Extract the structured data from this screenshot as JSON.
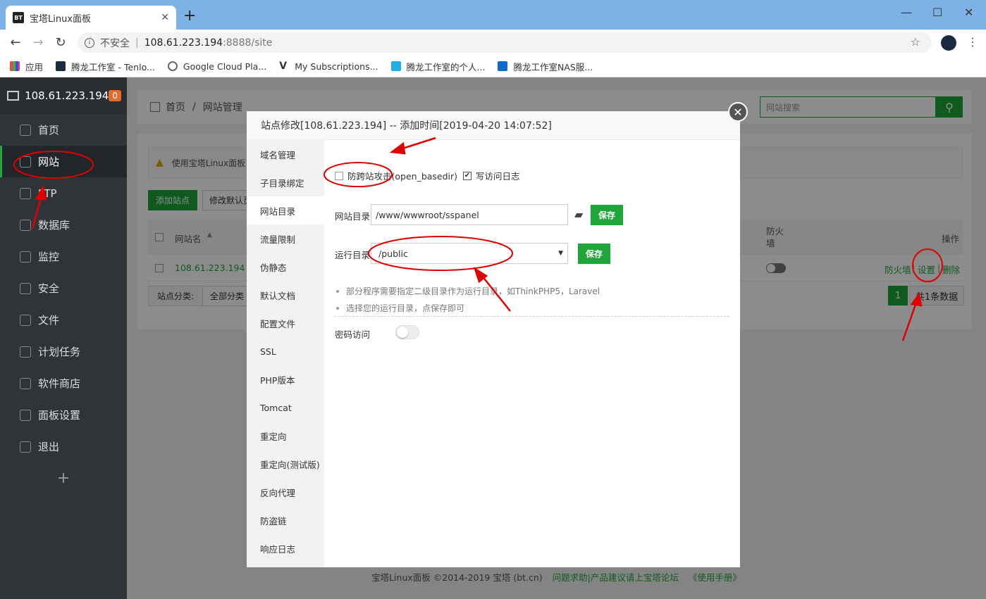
{
  "browser": {
    "tab_title": "宝塔Linux面板",
    "tab_favicon_text": "BT",
    "address": {
      "insecure_label": "不安全",
      "host": "108.61.223.194",
      "path": ":8888/site"
    },
    "bookmarks": [
      {
        "label": "应用",
        "icon": "apps-icon"
      },
      {
        "label": "腾龙工作室 - Tenlo...",
        "icon": "site-icon"
      },
      {
        "label": "Google Cloud Pla...",
        "icon": "gcp-icon"
      },
      {
        "label": "My Subscriptions...",
        "icon": "v-icon"
      },
      {
        "label": "腾龙工作室的个人...",
        "icon": "bilibili-icon"
      },
      {
        "label": "腾龙工作室NAS服...",
        "icon": "dsm-icon"
      }
    ]
  },
  "sidebar": {
    "server": "108.61.223.194",
    "badge": "0",
    "items": [
      {
        "label": "首页",
        "icon": "home-icon"
      },
      {
        "label": "网站",
        "icon": "globe-icon",
        "active": true
      },
      {
        "label": "FTP",
        "icon": "ftp-icon"
      },
      {
        "label": "数据库",
        "icon": "database-icon"
      },
      {
        "label": "监控",
        "icon": "monitor-icon"
      },
      {
        "label": "安全",
        "icon": "shield-icon"
      },
      {
        "label": "文件",
        "icon": "folder-icon"
      },
      {
        "label": "计划任务",
        "icon": "calendar-icon"
      },
      {
        "label": "软件商店",
        "icon": "grid-icon"
      },
      {
        "label": "面板设置",
        "icon": "gear-icon"
      },
      {
        "label": "退出",
        "icon": "logout-icon"
      }
    ],
    "plus": "+"
  },
  "main": {
    "breadcrumb": {
      "home": "首页",
      "sep": "/",
      "current": "网站管理"
    },
    "search_placeholder": "网站搜索",
    "alert": "使用宝塔Linux面板",
    "add_site": "添加站点",
    "modify_default": "修改默认页",
    "table": {
      "col_name": "网站名",
      "col_firewall": "防火墙",
      "col_action": "操作",
      "row": {
        "name": "108.61.223.194",
        "firewall": "防火墙",
        "sep": "|",
        "settings": "设置",
        "delete": "删除"
      }
    },
    "category_label": "站点分类:",
    "category_value": "全部分类",
    "page": "1",
    "total": "共1条数据",
    "footer": {
      "copyright": "宝塔Linux面板 ©2014-2019 宝塔 (bt.cn)",
      "forum": "问题求助|产品建议请上宝塔论坛",
      "manual": "《使用手册》"
    }
  },
  "modal": {
    "title": "站点修改[108.61.223.194] -- 添加时间[2019-04-20 14:07:52]",
    "nav": [
      "域名管理",
      "子目录绑定",
      "网站目录",
      "流量限制",
      "伪静态",
      "默认文档",
      "配置文件",
      "SSL",
      "PHP版本",
      "Tomcat",
      "重定向",
      "重定向(测试版)",
      "反向代理",
      "防盗链",
      "响应日志"
    ],
    "active_nav": "网站目录",
    "open_basedir_label": "防跨站攻击(open_basedir)",
    "open_basedir_checked": false,
    "access_log_label": "写访问日志",
    "access_log_checked": true,
    "site_dir_label": "网站目录",
    "site_dir_value": "/www/wwwroot/sspanel",
    "run_dir_label": "运行目录",
    "run_dir_value": "/public",
    "save_label": "保存",
    "tips": [
      "部分程序需要指定二级目录作为运行目录，如ThinkPHP5，Laravel",
      "选择您的运行目录，点保存即可"
    ],
    "password_label": "密码访问",
    "password_enabled": false
  },
  "colors": {
    "accent": "#20a53a",
    "annotation": "#e00000",
    "sidebar": "#2f3439"
  }
}
